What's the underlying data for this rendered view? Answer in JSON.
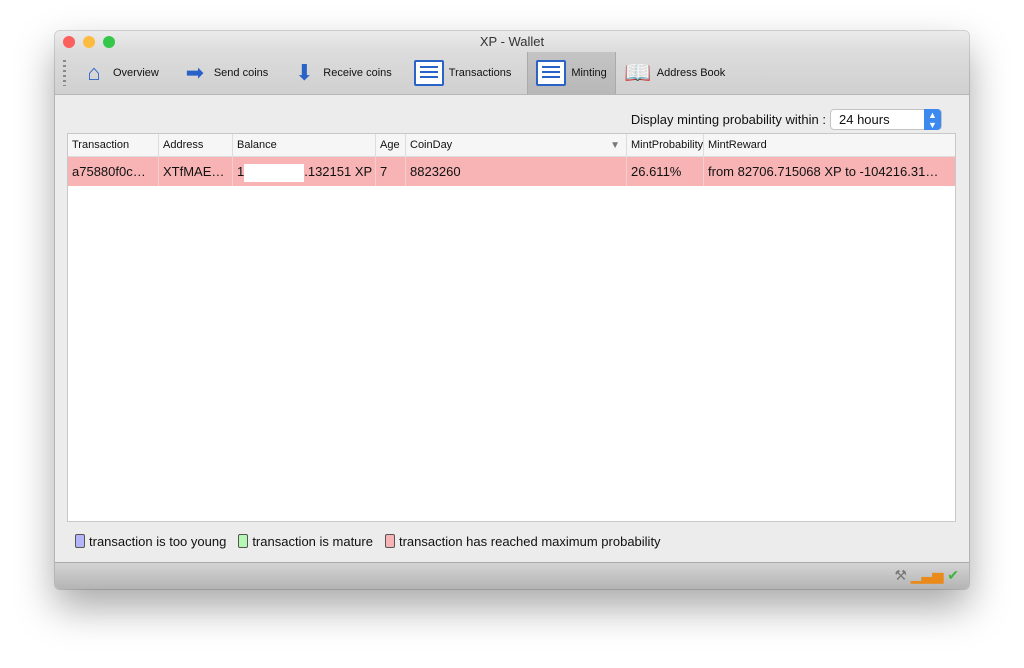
{
  "window": {
    "title": "XP - Wallet"
  },
  "toolbar": {
    "items": [
      {
        "label": "Overview",
        "icon": "home-icon"
      },
      {
        "label": "Send coins",
        "icon": "arrow-right-icon"
      },
      {
        "label": "Receive coins",
        "icon": "arrow-down-icon"
      },
      {
        "label": "Transactions",
        "icon": "list-icon"
      },
      {
        "label": "Minting",
        "icon": "list-icon",
        "active": true
      },
      {
        "label": "Address Book",
        "icon": "book-icon"
      }
    ]
  },
  "filter": {
    "label": "Display minting probability within :",
    "value": "24 hours"
  },
  "table": {
    "columns": [
      "Transaction",
      "Address",
      "Balance",
      "Age",
      "CoinDay",
      "MintProbability",
      "MintReward"
    ],
    "sorted_column": "CoinDay",
    "rows": [
      {
        "transaction": "a75880f0c…",
        "address": "XTfMAE…",
        "balance_prefix": "1",
        "balance_suffix": ".132151 XP",
        "age": "7",
        "coinday": "8823260",
        "probability": "26.611%",
        "reward": "from  82706.715068 XP to -104216.31…",
        "status_color": "#f8b4b4"
      }
    ]
  },
  "legend": [
    {
      "label": "transaction is too young",
      "color": "#b4b4f8"
    },
    {
      "label": "transaction is mature",
      "color": "#b4f8b4"
    },
    {
      "label": "transaction has reached maximum probability",
      "color": "#f8b4b4"
    }
  ],
  "statusbar": {
    "icons": [
      "tools-icon",
      "signal-bars-icon",
      "checkmark-icon"
    ]
  }
}
